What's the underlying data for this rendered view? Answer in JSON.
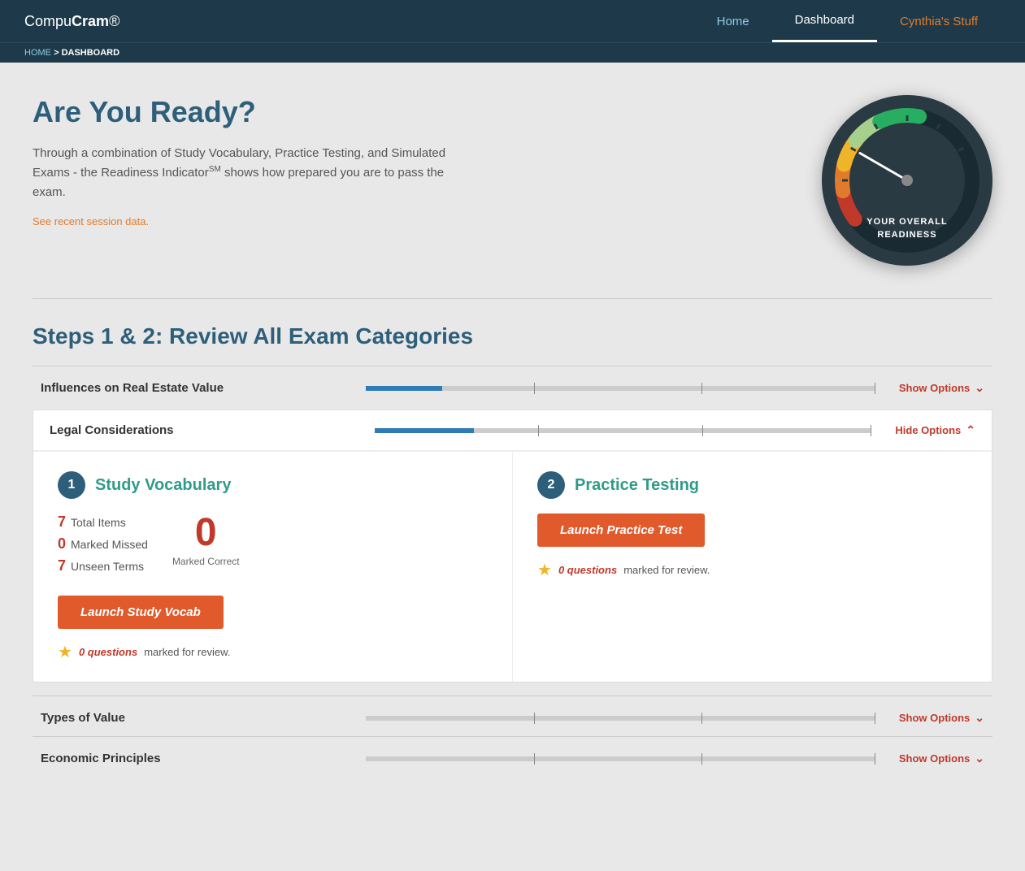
{
  "nav": {
    "logo_light": "Compu",
    "logo_bold": "Cram",
    "logo_symbol": "®",
    "links": [
      {
        "label": "Home",
        "active": false
      },
      {
        "label": "Dashboard",
        "active": true
      },
      {
        "label": "Cynthia's Stuff",
        "active": false,
        "special": true
      }
    ]
  },
  "breadcrumb": {
    "home": "HOME",
    "separator": ">",
    "current": "DASHBOARD"
  },
  "hero": {
    "title": "Are You Ready?",
    "description": "Through a combination of Study Vocabulary, Practice Testing, and Simulated Exams - the Readiness Indicator",
    "superscript": "SM",
    "description2": " shows how prepared you are to pass the exam.",
    "link": "See recent session data.",
    "gauge_label": "YOUR OVERALL\nREADINESS"
  },
  "steps_title": "Steps 1 & 2: Review All Exam Categories",
  "categories": [
    {
      "name": "Influences on Real Estate Value",
      "expanded": false,
      "show_options_label": "Show Options",
      "progress": 15
    },
    {
      "name": "Legal Considerations",
      "expanded": true,
      "hide_options_label": "Hide Options",
      "progress": 20,
      "study_vocab": {
        "step": "1",
        "title": "Study Vocabulary",
        "total_items_label": "Total Items",
        "total_items": "7",
        "marked_missed_label": "Marked Missed",
        "marked_missed": "0",
        "unseen_terms_label": "Unseen Terms",
        "unseen_terms": "7",
        "marked_correct": "0",
        "marked_correct_label": "Marked Correct",
        "launch_btn": "Launch Study Vocab",
        "review_count": "0 questions",
        "review_suffix": "marked for review."
      },
      "practice_testing": {
        "step": "2",
        "title": "Practice Testing",
        "launch_btn": "Launch Practice Test",
        "review_count": "0 questions",
        "review_suffix": "marked for review."
      }
    },
    {
      "name": "Types of Value",
      "expanded": false,
      "show_options_label": "Show Options",
      "progress": 0
    },
    {
      "name": "Economic Principles",
      "expanded": false,
      "show_options_label": "Show Options",
      "progress": 0
    }
  ]
}
